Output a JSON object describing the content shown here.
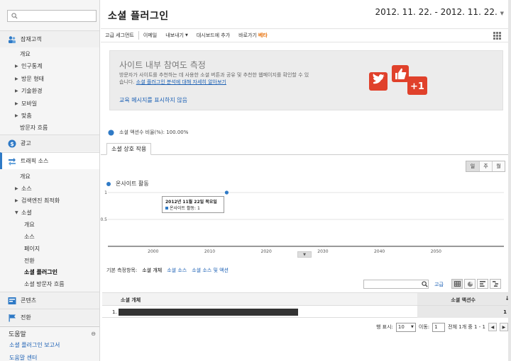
{
  "sidebar": {
    "search_placeholder": "",
    "sections": [
      {
        "label": "잠재고객",
        "icon": "people-icon"
      },
      {
        "label": "광고",
        "icon": "dollar-icon"
      },
      {
        "label": "트래픽 소스",
        "icon": "traffic-arrows-icon"
      },
      {
        "label": "콘텐츠",
        "icon": "content-icon"
      },
      {
        "label": "전환",
        "icon": "flag-icon"
      }
    ],
    "audience_items": [
      "개요",
      "인구통계",
      "방문 형태",
      "기술환경",
      "모바일",
      "맞춤",
      "방문자 흐름"
    ],
    "traffic_items": [
      "개요",
      "소스",
      "검색엔진 최적화",
      "소셜"
    ],
    "social_items": [
      "개요",
      "소스",
      "페이지",
      "전환",
      "소셜 플러그인",
      "소셜 방문자 흐름"
    ],
    "help_title": "도움말",
    "help_collapse": "⊖",
    "help_links": [
      "소셜 플러그인 보고서",
      "도움말 센터"
    ]
  },
  "header": {
    "title": "소셜 플러그인",
    "date_range": "2012. 11. 22. - 2012. 11. 22."
  },
  "toolbar": {
    "items": [
      "고급 세그먼트",
      "이메일",
      "내보내기",
      "대시보드에 추가",
      "바로가기"
    ],
    "beta": "베타"
  },
  "info": {
    "title": "사이트 내부 참여도 측정",
    "text": "방문자가 사이트를 추천하는 데 사용한 소셜 버튼과 공유 및 추천한 웹페이지를 확인할 수 있습니다.",
    "link": "소셜 플러그인 분석에 대해 자세히 알아보기",
    "hide": "교육 메시지를 표시하지 않음",
    "plus_one": "+1"
  },
  "ratio_text": "소셜 액션수 비율(%): 100.00%",
  "tab_label": "소셜 상호 작용",
  "granularity": [
    "일",
    "주",
    "월"
  ],
  "chart_legend": "온사이트 활동",
  "chart_data": {
    "type": "scatter",
    "title": "",
    "series": [
      {
        "name": "온사이트 활동",
        "x": [
          2013
        ],
        "y": [
          1
        ]
      }
    ],
    "xlim": [
      1992,
      2062
    ],
    "ylim": [
      0,
      1
    ],
    "xticks": [
      "2000",
      "2010",
      "2020",
      "2030",
      "2040",
      "2050"
    ],
    "yticks": [
      "1",
      "0.5"
    ],
    "grid": true
  },
  "tooltip": {
    "date": "2012년 11월 22일 목요일",
    "line": "온사이트 활동: 1"
  },
  "dimensions": {
    "label": "기본 측정항목:",
    "current": "소셜 개체",
    "options": [
      "소셜 소스",
      "소셜 소스 및 액션"
    ]
  },
  "table_tools": {
    "search_value": "",
    "advanced": "고급"
  },
  "table": {
    "col1": "소셜 개체",
    "col2": "소셜 액션수",
    "sort": "↓",
    "rows": [
      {
        "index": "1.",
        "value": "1"
      }
    ]
  },
  "pager": {
    "rows_label": "행 표시:",
    "rows_value": "10",
    "goto_label": "이동:",
    "goto_value": "1",
    "summary": "전체 1개 중 1 - 1"
  }
}
